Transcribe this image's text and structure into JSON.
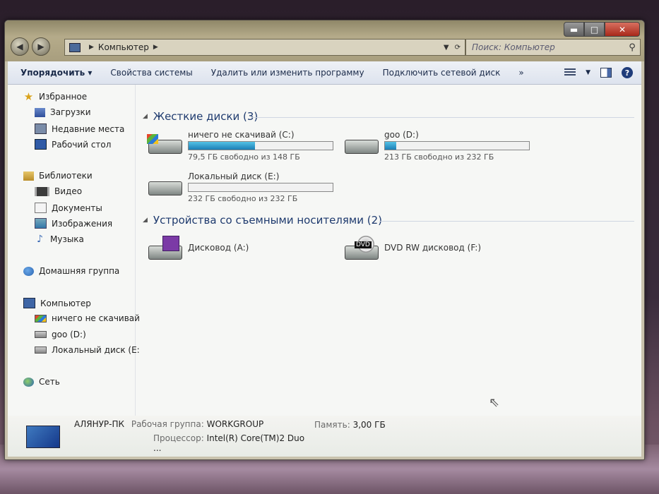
{
  "window": {
    "address": {
      "crumbs": [
        "Компьютер"
      ]
    },
    "search_placeholder": "Поиск: Компьютер",
    "buttons": {
      "minimize": "▬",
      "maximize": "□",
      "close": "✕"
    }
  },
  "toolbar": {
    "organize": "Упорядочить ▾",
    "system_properties": "Свойства системы",
    "uninstall": "Удалить или изменить программу",
    "map_drive": "Подключить сетевой диск",
    "more": "»",
    "help": "?"
  },
  "sidebar": {
    "favorites": "Избранное",
    "downloads": "Загрузки",
    "recent": "Недавние места",
    "desktop": "Рабочий стол",
    "libraries": "Библиотеки",
    "video": "Видео",
    "documents": "Документы",
    "images": "Изображения",
    "music": "Музыка",
    "homegroup": "Домашняя группа",
    "computer": "Компьютер",
    "drive_c": "ничего не скачивай",
    "drive_d": "goo (D:)",
    "drive_e": "Локальный диск (E:",
    "network": "Сеть"
  },
  "main": {
    "hdd_group": "Жесткие диски (3)",
    "removable_group": "Устройства со съемными носителями (2)",
    "drives": {
      "c": {
        "name": "ничего не скачивай (C:)",
        "free_text": "79,5 ГБ свободно из 148 ГБ",
        "used_fraction": 0.46
      },
      "d": {
        "name": "goo (D:)",
        "free_text": "213 ГБ свободно из 232 ГБ",
        "used_fraction": 0.08
      },
      "e": {
        "name": "Локальный диск (E:)",
        "free_text": "232 ГБ свободно из 232 ГБ",
        "used_fraction": 0.0
      },
      "a": {
        "name": "Дисковод (A:)"
      },
      "f": {
        "name": "DVD RW дисковод (F:)",
        "icon_label": "DVD"
      }
    }
  },
  "details": {
    "pc_name": "АЛЯНУР-ПК",
    "workgroup_label": "Рабочая группа:",
    "workgroup_value": "WORKGROUP",
    "memory_label": "Память:",
    "memory_value": "3,00 ГБ",
    "cpu_label": "Процессор:",
    "cpu_value": "Intel(R) Core(TM)2 Duo ..."
  },
  "colors": {
    "progress": "#1d7fb6",
    "toolbar_text": "#1b2b4a",
    "group_header": "#1e3a6e"
  }
}
